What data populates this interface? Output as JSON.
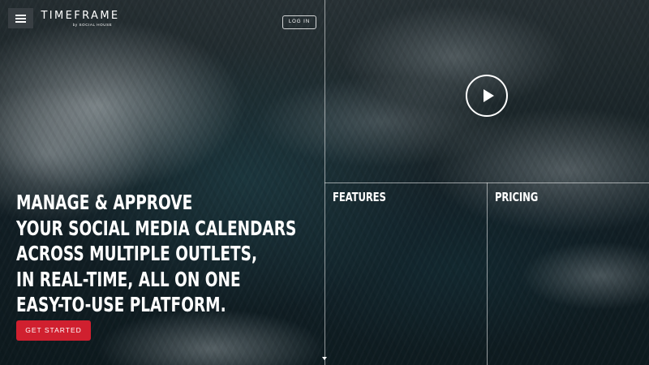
{
  "header": {
    "menu_icon": "hamburger-menu-icon",
    "logo_main": "TIMEFRAME",
    "logo_sub": "by SOCIAL HOUSE",
    "login_label": "LOG IN"
  },
  "hero": {
    "headline_lines": [
      "MANAGE & APPROVE",
      "YOUR SOCIAL MEDIA CALENDARS",
      "ACROSS MULTIPLE OUTLETS,",
      "IN REAL-TIME, ALL ON ONE",
      "EASY-TO-USE PLATFORM."
    ],
    "cta_label": "GET STARTED",
    "play_icon": "play-icon",
    "scroll_icon": "scroll-down-arrow-icon"
  },
  "tiles": {
    "features_label": "FEATURES",
    "pricing_label": "PRICING"
  },
  "colors": {
    "accent": "#d0202f",
    "text": "#ffffff",
    "menu_button_bg": "#3c4246"
  }
}
